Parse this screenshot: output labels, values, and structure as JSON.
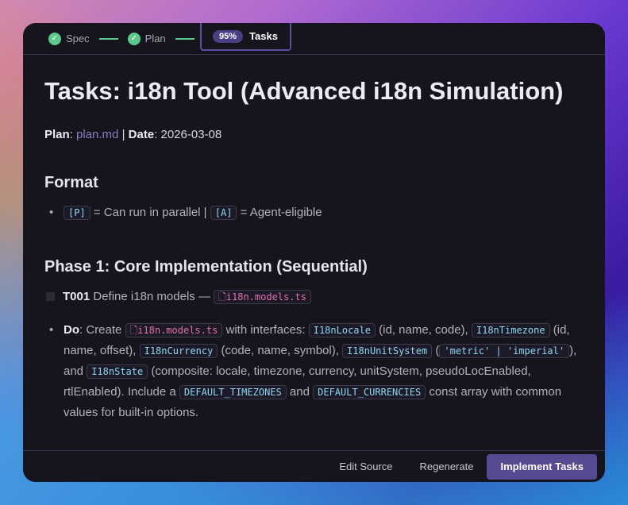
{
  "steps": [
    {
      "label": "Spec"
    },
    {
      "label": "Plan"
    }
  ],
  "active_step": {
    "label": "Tasks",
    "progress": "95%"
  },
  "title": "Tasks: i18n Tool (Advanced i18n Simulation)",
  "meta": {
    "plan_label": "Plan",
    "plan_link": "plan.md",
    "sep": " | ",
    "date_label": "Date",
    "date": "2026-03-08"
  },
  "format": {
    "heading": "Format",
    "p": "[P]",
    "p_text": " = Can run in parallel | ",
    "a": "[A]",
    "a_text": " = Agent-eligible"
  },
  "phase1": {
    "heading": "Phase 1: Core Implementation (Sequential)",
    "task_id": "T001",
    "task_text": " Define i18n models — ",
    "task_file": "i18n.models.ts",
    "do_label": "Do",
    "t1": ": Create ",
    "file": "i18n.models.ts",
    "t2": " with interfaces: ",
    "c1": "I18nLocale",
    "t3": " (id, name, code), ",
    "c2": "I18nTimezone",
    "t4": " (id, name, offset), ",
    "c3": "I18nCurrency",
    "t5": " (code, name, symbol), ",
    "c4": "I18nUnitSystem",
    "t6": " (",
    "c5": "'metric' | 'imperial'",
    "t7": "), and ",
    "c6": "I18nState",
    "t8": " (composite: locale, timezone, currency, unitSystem, pseudoLocEnabled, rtlEnabled). Include a ",
    "c7": "DEFAULT_TIMEZONES",
    "t9": " and ",
    "c8": "DEFAULT_CURRENCIES",
    "t10": " const array with common values for built-in options."
  },
  "footer": {
    "edit": "Edit Source",
    "regen": "Regenerate",
    "implement": "Implement Tasks"
  }
}
